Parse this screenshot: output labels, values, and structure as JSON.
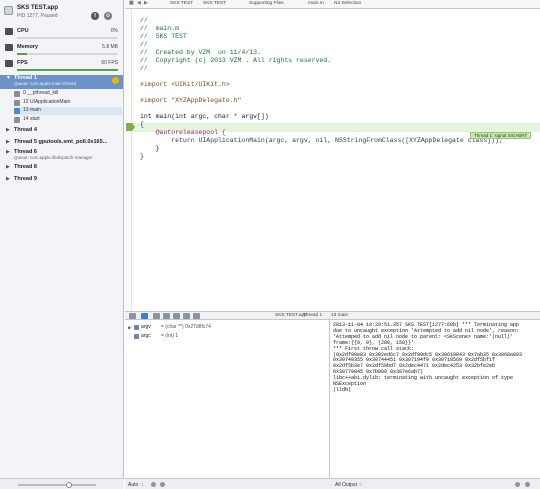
{
  "process": {
    "name": "SKS TEST.app",
    "pid": "PID 1277, Paused"
  },
  "gauges": [
    {
      "label": "CPU",
      "value": "0%",
      "fraction": 0.0
    },
    {
      "label": "Memory",
      "value": "5.8 MB",
      "fraction": 0.1
    },
    {
      "label": "FPS",
      "value": "60 FPS",
      "fraction": 1.0
    }
  ],
  "threads": {
    "thread1": {
      "label": "Thread 1",
      "queue": "Queue: com.apple.main-thread"
    },
    "frames": [
      {
        "label": "0 __pthread_kill"
      },
      {
        "label": "12 UIApplicationMain"
      },
      {
        "label": "13 main"
      },
      {
        "label": "14 start"
      }
    ],
    "others": [
      {
        "label": "Thread 4",
        "queue": ""
      },
      {
        "label": "Thread 5 gputools.smt_poll.0x165...",
        "queue": ""
      },
      {
        "label": "Thread 6",
        "queue": "Queue: com.apple.libdispatch-manager"
      },
      {
        "label": "Thread 8",
        "queue": ""
      },
      {
        "label": "Thread 9",
        "queue": ""
      }
    ]
  },
  "jumpbar": [
    "SKS TEST",
    "SKS TEST",
    "Supporting Files",
    "main.m",
    "No Selection"
  ],
  "code": {
    "lines": [
      "//",
      "//  main.m",
      "//  SKS TEST",
      "//",
      "//  Created by VZM  on 11/4/13.",
      "//  Copyright (c) 2013 VZM . All rights reserved.",
      "//",
      "",
      "#import <UIKit/UIKit.h>",
      "",
      "#import \"XYZAppDelegate.h\"",
      "",
      "int main(int argc, char * argv[])",
      "{",
      "    @autoreleasepool {",
      "        return UIApplicationMain(argc, argv, nil, NSStringFromClass([XYZAppDelegate class]));",
      "    }",
      "}"
    ],
    "signal": "Thread 1: signal SIGABRT"
  },
  "debugbar": {
    "crumbs": [
      "SKS TEST.app",
      "Thread 1",
      "13 main"
    ]
  },
  "variables": [
    {
      "name": "argv",
      "value": "= (char **) 0x27d8fc74"
    },
    {
      "name": "argc",
      "value": "= (int) 1"
    }
  ],
  "console": [
    "2013-11-04 19:29:51.357 SKS TEST[1277:60b] *** Terminating app",
    "due to uncaught exception 'Attempted to add nil node', reason:",
    "'Attemped to add nil node to parent: <SKScene> name:'(null)'",
    "frame:{{0, 0}, {280, 150}}'",
    "*** First throw call stack:",
    "(0x2df90e83 0x382ed6c7 0x2df90dc5 0x30619843 0x7ab35 0x3068a893",
    "0x30749355 0x30744451 0x307194f9 0x30718569 0x2df5bf1f",
    "0x2df5b3e7 0x2df59bd7 0x2dec4471 0x2dec4253 0x32bfe2eb",
    "0x30779845 0x7b809 0x387e6ab7)",
    "libc++abi.dylib: terminating with uncaught exception of type",
    "NSException",
    "(lldb)"
  ],
  "bottom": {
    "auto": "Auto ♢",
    "output": "All Output ♢"
  }
}
